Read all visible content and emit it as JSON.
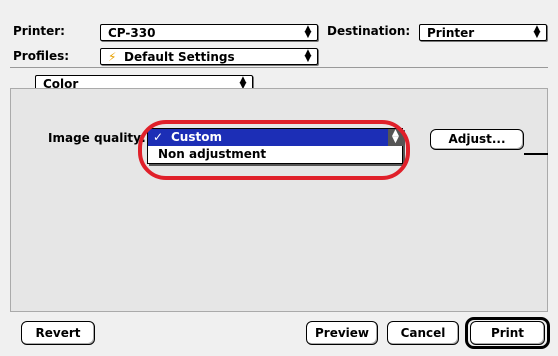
{
  "header": {
    "printer_label": "Printer:",
    "printer_value": "CP-330",
    "destination_label": "Destination:",
    "destination_value": "Printer",
    "profiles_label": "Profiles:",
    "profiles_value": "Default Settings",
    "section_value": "Color"
  },
  "panel": {
    "image_quality_label": "Image quality:",
    "menu_checkmark": "✓",
    "menu_items": [
      "Custom",
      "Non adjustment"
    ],
    "selected_item": "Custom",
    "adjust_button": "Adjust..."
  },
  "footer": {
    "revert_button": "Revert",
    "preview_button": "Preview",
    "cancel_button": "Cancel",
    "print_button": "Print"
  },
  "colors": {
    "selection": "#1c2eb6",
    "highlight_ring": "#e0202a",
    "profile_icon": "#e8a000"
  }
}
